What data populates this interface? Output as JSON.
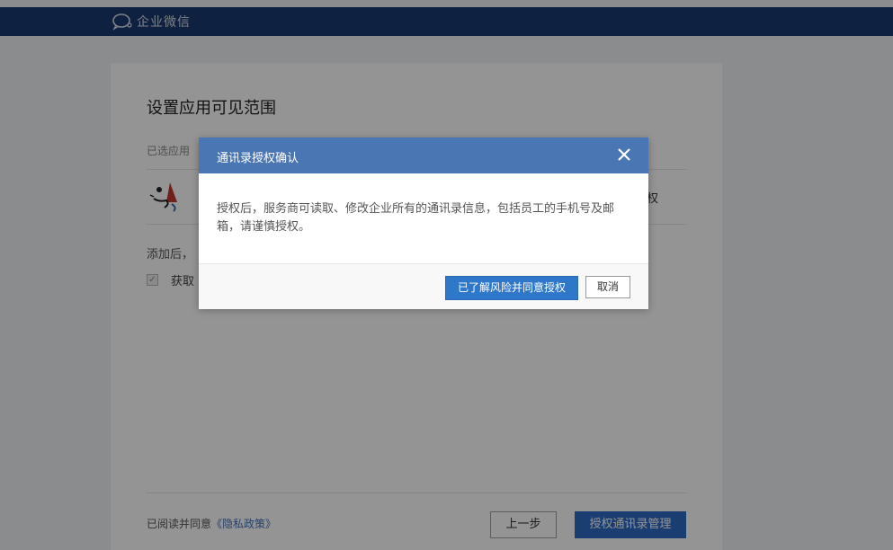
{
  "header": {
    "logo_text": "企业微信"
  },
  "page": {
    "title": "设置应用可见范围",
    "selected_label": "已选应用",
    "app_name": "",
    "app_right_text": "权",
    "add_text": "添加后，",
    "permission_label": "获取"
  },
  "footer": {
    "agreement_prefix": "已阅读并同意",
    "privacy_link": "《隐私政策》",
    "prev_button": "上一步",
    "authorize_button": "授权通讯录管理"
  },
  "modal": {
    "title": "通讯录授权确认",
    "body": "授权后，服务商可读取、修改企业所有的通讯录信息，包括员工的手机号及邮箱，请谨慎授权。",
    "confirm_button": "已了解风险并同意授权",
    "cancel_button": "取消",
    "close_icon": "close-icon"
  },
  "colors": {
    "topbar": "#1a3a6e",
    "modal_header": "#4a76b4",
    "primary_button": "#2e77c9"
  }
}
